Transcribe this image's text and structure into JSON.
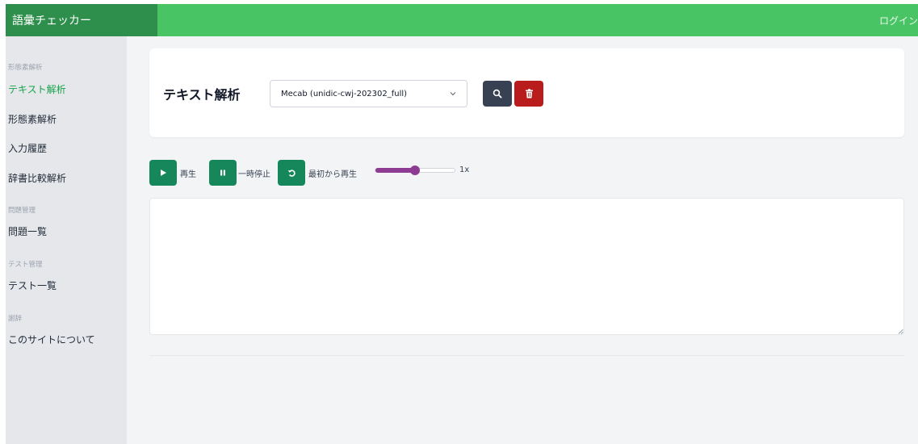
{
  "header": {
    "brand": "語彙チェッカー",
    "login_label": "ログイン"
  },
  "sidebar": {
    "sections": [
      {
        "label": "形態素解析"
      },
      {
        "label": "問題管理"
      },
      {
        "label": "テスト管理"
      },
      {
        "label": "謝辞"
      }
    ],
    "items": [
      {
        "label": "テキスト解析",
        "active": true
      },
      {
        "label": "形態素解析"
      },
      {
        "label": "入力履歴"
      },
      {
        "label": "辞書比較解析"
      },
      {
        "label": "問題一覧"
      },
      {
        "label": "テスト一覧"
      },
      {
        "label": "このサイトについて"
      }
    ]
  },
  "analysis": {
    "title": "テキスト解析",
    "dictionary_selected": "Mecab (unidic-cwj-202302_full)",
    "search_icon": "search-icon",
    "delete_icon": "trash-icon"
  },
  "player": {
    "play_label": "再生",
    "pause_label": "一時停止",
    "restart_label": "最初から再生",
    "speed_label": "1x",
    "speed_fraction": 0.5
  },
  "text_input": {
    "value": "",
    "placeholder": ""
  },
  "colors": {
    "header": "#48c464",
    "brand_bg": "#2e8f4c",
    "active_nav": "#16a34a",
    "search_button": "#374151",
    "delete_button": "#b91c1c",
    "player_button": "#16875a",
    "slider": "#8e3b93"
  }
}
